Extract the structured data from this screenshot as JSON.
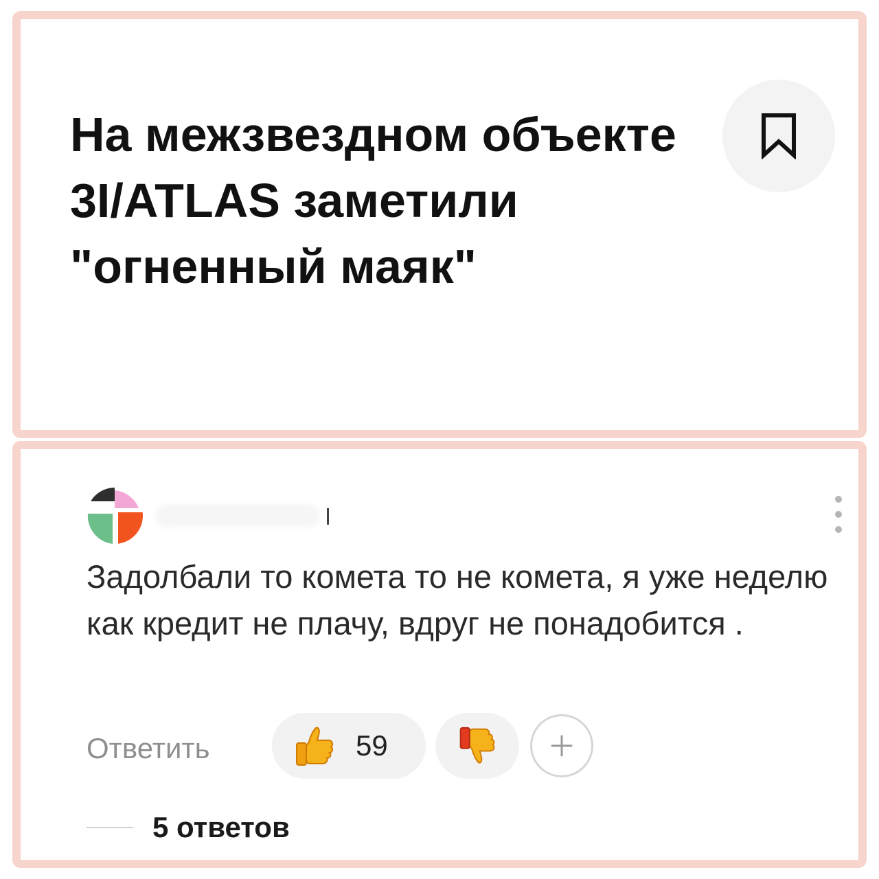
{
  "article": {
    "title": "На межзвездном объекте 3I/ATLAS заметили \"огненный маяк\"",
    "bookmark_icon": "bookmark-icon"
  },
  "comment": {
    "author_avatar_colors": [
      "#2e2e2e",
      "#f2a7d6",
      "#6dbf8a",
      "#f2541f"
    ],
    "text": "Задолбали то комета то не комета, я уже неделю как кредит не плачу, вдруг не понадобится .",
    "reply_label": "Ответить",
    "likes": "59",
    "like_icon": "thumbs-up-icon",
    "dislike_icon": "thumbs-down-icon",
    "add_reaction_icon": "plus-icon",
    "more_icon": "more-vertical-icon",
    "replies_label": "5 ответов"
  },
  "colors": {
    "frame": "#f7d4cc",
    "pill_bg": "#f2f2f2",
    "muted_text": "#8f8f8f"
  }
}
